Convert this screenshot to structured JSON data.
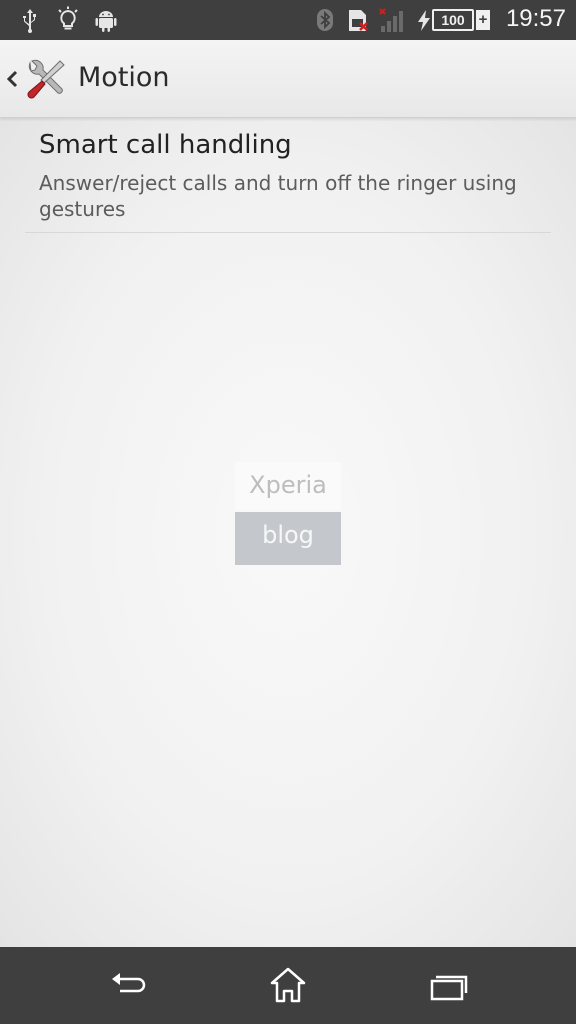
{
  "status_bar": {
    "time": "19:57",
    "battery_level": "100",
    "battery_plus": "+",
    "icons": [
      "usb-icon",
      "bulb-icon",
      "android-icon",
      "bluetooth-icon",
      "sim-icon",
      "signal-icon",
      "charging-icon",
      "battery-icon"
    ]
  },
  "action_bar": {
    "title": "Motion",
    "icon": "tools-icon"
  },
  "list": {
    "items": [
      {
        "title": "Smart call handling",
        "summary": "Answer/reject calls and turn off the ringer using gestures"
      }
    ]
  },
  "watermark": {
    "line1": "Xperia",
    "line2": "blog"
  },
  "nav_bar": {
    "buttons": [
      "back-icon",
      "home-icon",
      "recent-apps-icon"
    ]
  },
  "colors": {
    "status_bar": "#3f3f3f",
    "nav_bar": "#3f3f3f",
    "background": "#efefef"
  }
}
